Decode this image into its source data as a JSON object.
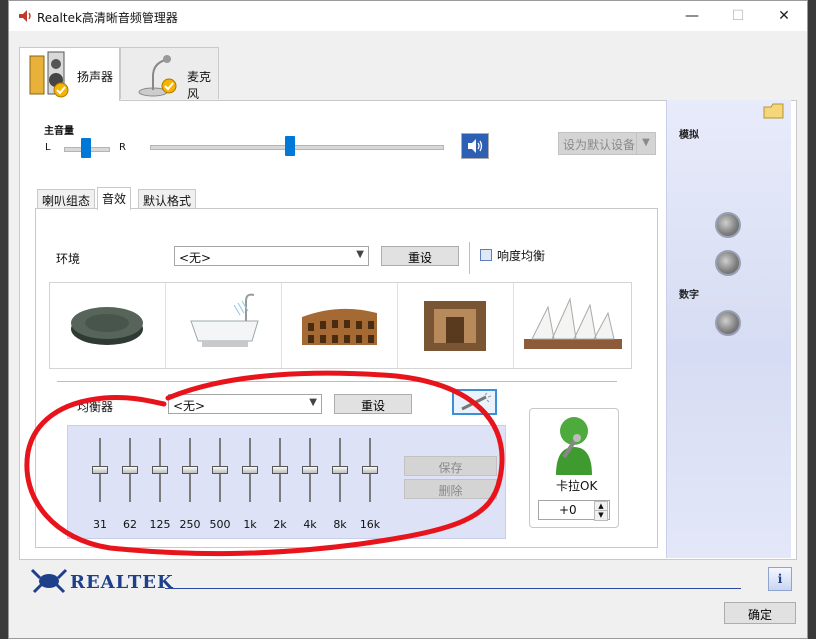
{
  "window": {
    "title": "Realtek高清晰音频管理器",
    "controls": {
      "minimize": "—",
      "maximize": "☐",
      "close": "✕"
    }
  },
  "device_tabs": [
    {
      "label": "扬声器",
      "icon": "speaker-icon",
      "active": true
    },
    {
      "label": "麦克风",
      "icon": "microphone-icon",
      "active": false
    }
  ],
  "main_volume": {
    "title": "主音量",
    "left": "L",
    "right": "R",
    "balance": 0.5,
    "level": 0.48,
    "mute_icon": "speaker-volume-icon"
  },
  "set_default": {
    "label": "设为默认设备"
  },
  "right_panel": {
    "analog": "模拟",
    "digital": "数字"
  },
  "sub_tabs": [
    {
      "label": "喇叭组态",
      "active": false
    },
    {
      "label": "音效",
      "active": true
    },
    {
      "label": "默认格式",
      "active": false
    }
  ],
  "environment": {
    "label": "环境",
    "selected": "<无>",
    "reset": "重设",
    "loudness": {
      "label": "响度均衡",
      "checked": false
    },
    "presets": [
      "stone-disc-icon",
      "bathtub-icon",
      "colosseum-icon",
      "stone-room-icon",
      "opera-house-icon"
    ]
  },
  "equalizer": {
    "label": "均衡器",
    "selected": "<无>",
    "reset": "重设",
    "save": "保存",
    "delete": "删除",
    "bands": [
      "31",
      "62",
      "125",
      "250",
      "500",
      "1k",
      "2k",
      "4k",
      "8k",
      "16k"
    ]
  },
  "karaoke": {
    "label": "卡拉OK",
    "value": "+0"
  },
  "footer": {
    "brand": "REALTEK",
    "ok": "确定"
  },
  "colors": {
    "accent": "#0078d7",
    "annotation": "#e8141c",
    "brand": "#1e3f8a"
  }
}
